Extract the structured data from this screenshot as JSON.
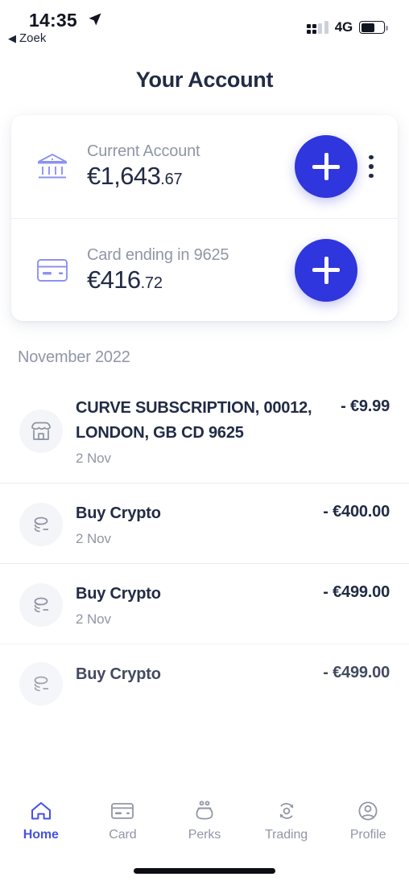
{
  "status_bar": {
    "time": "14:35",
    "location_icon": "location-arrow-icon",
    "back_label": "Zoek",
    "back_caret": "◀",
    "network": "4G",
    "battery_level_pct": 62
  },
  "header": {
    "title": "Your Account"
  },
  "accounts": [
    {
      "icon": "bank-icon",
      "label": "Current Account",
      "currency_amount": "€1,643",
      "cents": ".67",
      "add_button_label": "+",
      "has_menu": true,
      "menu_label": "more-options"
    },
    {
      "icon": "credit-card-icon",
      "label": "Card ending in 9625",
      "currency_amount": "€416",
      "cents": ".72",
      "add_button_label": "+",
      "has_menu": false,
      "menu_label": ""
    }
  ],
  "transactions": {
    "section_title": "November 2022",
    "items": [
      {
        "icon": "store-icon",
        "title": "CURVE SUBSCRIPTION, 00012, LONDON, GB CD 9625",
        "date": "2 Nov",
        "amount": "- €9.99"
      },
      {
        "icon": "coins-minus-icon",
        "title": "Buy Crypto",
        "date": "2 Nov",
        "amount": "- €400.00"
      },
      {
        "icon": "coins-minus-icon",
        "title": "Buy Crypto",
        "date": "2 Nov",
        "amount": "- €499.00"
      },
      {
        "icon": "coins-minus-icon",
        "title": "Buy Crypto",
        "date": "",
        "amount": "- €499.00"
      }
    ]
  },
  "tab_bar": {
    "items": [
      {
        "label": "Home",
        "icon": "home-icon",
        "active": true
      },
      {
        "label": "Card",
        "icon": "card-icon",
        "active": false
      },
      {
        "label": "Perks",
        "icon": "purse-icon",
        "active": false
      },
      {
        "label": "Trading",
        "icon": "refresh-circle-icon",
        "active": false
      },
      {
        "label": "Profile",
        "icon": "person-circle-icon",
        "active": false
      }
    ]
  },
  "colors": {
    "accent_blue": "#2f36dd",
    "tab_active": "#4552e6",
    "text_dark": "#222b45",
    "text_muted": "#9096a6",
    "icon_periwinkle": "#8d92f0"
  }
}
